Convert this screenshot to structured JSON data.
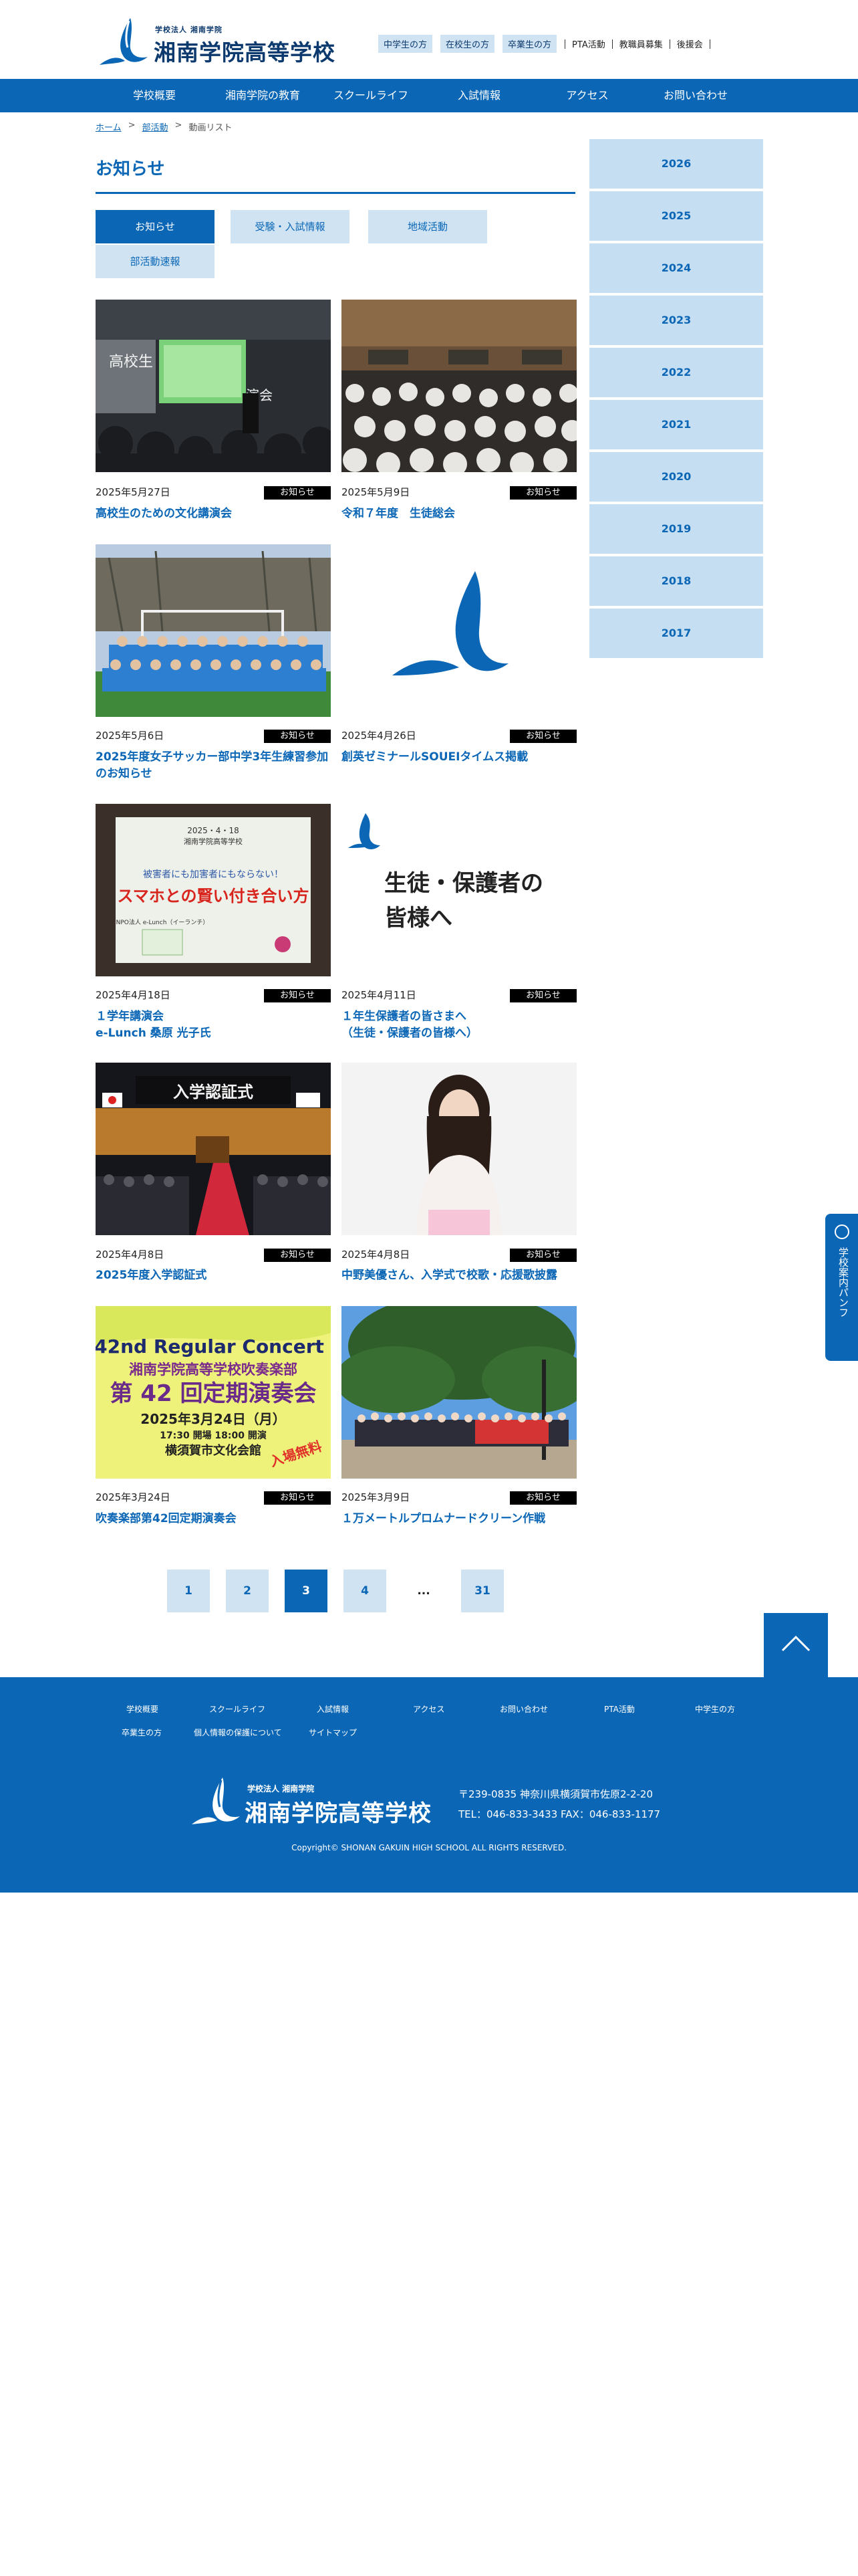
{
  "header": {
    "logo_small": "学校法人 湘南学院",
    "logo_big": "湘南学院高等学校",
    "top_links_pill": [
      "中学生の方",
      "在校生の方",
      "卒業生の方"
    ],
    "top_links_plain": [
      "PTA活動",
      "教職員募集",
      "後援会"
    ]
  },
  "main_nav": [
    "学校概要",
    "湘南学院の教育",
    "スクールライフ",
    "入試情報",
    "アクセス",
    "お問い合わせ"
  ],
  "breadcrumb": {
    "home": "ホーム",
    "section": "部活動",
    "current": "動画リスト",
    "sep": ">"
  },
  "page_title": "お知らせ",
  "categories": [
    "お知らせ",
    "受験・入試情報",
    "地域活動",
    "部活動速報"
  ],
  "posts": [
    {
      "date": "2025年5月27日",
      "badge": "お知らせ",
      "title": "高校生のための文化講演会"
    },
    {
      "date": "2025年5月9日",
      "badge": "お知らせ",
      "title": "令和７年度　生徒総会"
    },
    {
      "date": "2025年5月6日",
      "badge": "お知らせ",
      "title": "2025年度女子サッカー部中学3年生練習参加のお知らせ"
    },
    {
      "date": "2025年4月26日",
      "badge": "お知らせ",
      "title": "創英ゼミナールSOUEIタイムス掲載"
    },
    {
      "date": "2025年4月18日",
      "badge": "お知らせ",
      "title": "１学年講演会\ne-Lunch 桑原 光子氏"
    },
    {
      "date": "2025年4月11日",
      "badge": "お知らせ",
      "title": "１年生保護者の皆さまへ\n（生徒・保護者の皆様へ）"
    },
    {
      "date": "2025年4月8日",
      "badge": "お知らせ",
      "title": "2025年度入学認証式"
    },
    {
      "date": "2025年4月8日",
      "badge": "お知らせ",
      "title": "中野美優さん、入学式で校歌・応援歌披露"
    },
    {
      "date": "2025年3月24日",
      "badge": "お知らせ",
      "title": "吹奏楽部第42回定期演奏会"
    },
    {
      "date": "2025年3月9日",
      "badge": "お知らせ",
      "title": "１万メートルプロムナードクリーン作戦"
    }
  ],
  "image_text": {
    "slide1_line1": "高校生",
    "slide1_line2": "演会",
    "slide5_date": "2025・4・18",
    "slide5_school": "湘南学院高等学校",
    "slide5_sub": "被害者にも加害者にもならない！",
    "slide5_main": "スマホとの賢い付き合い方",
    "slide5_org": "NPO法人 e-Lunch（イーランチ）",
    "notice_line1": "生徒・保護者の",
    "notice_line2": "皆様へ",
    "ceremony_banner": "入学認証式",
    "concert_top": "42nd Regular Concert",
    "concert_school": "湘南学院高等学校吹奏楽部",
    "concert_main": "第 42 回定期演奏会",
    "concert_date": "2025年3月24日（月）",
    "concert_time": "17:30 開場 18:00 開演",
    "concert_venue": "横須賀市文化会館",
    "concert_free": "入場無料"
  },
  "pagination": [
    "1",
    "2",
    "3",
    "4",
    "...",
    "31"
  ],
  "current_page": "3",
  "years": [
    "2026",
    "2025",
    "2024",
    "2023",
    "2022",
    "2021",
    "2020",
    "2019",
    "2018",
    "2017"
  ],
  "pamphlet_label": "学校案内パンフ",
  "footer": {
    "nav_row1": [
      "学校概要",
      "スクールライフ",
      "入試情報",
      "アクセス",
      "お問い合わせ",
      "PTA活動",
      "中学生の方"
    ],
    "nav_row2": [
      "卒業生の方",
      "個人情報の保護について",
      "サイトマップ"
    ],
    "logo_small": "学校法人 湘南学院",
    "logo_big": "湘南学院高等学校",
    "address": "〒239-0835 神奈川県横須賀市佐原2-2-20",
    "phone": "TEL：046-833-3433 FAX：046-833-1177",
    "copyright": "Copyright© SHONAN GAKUIN HIGH SCHOOL ALL RIGHTS RESERVED."
  },
  "colors": {
    "primary": "#0b67b6",
    "light": "#cfe3f3",
    "text": "#222222"
  }
}
